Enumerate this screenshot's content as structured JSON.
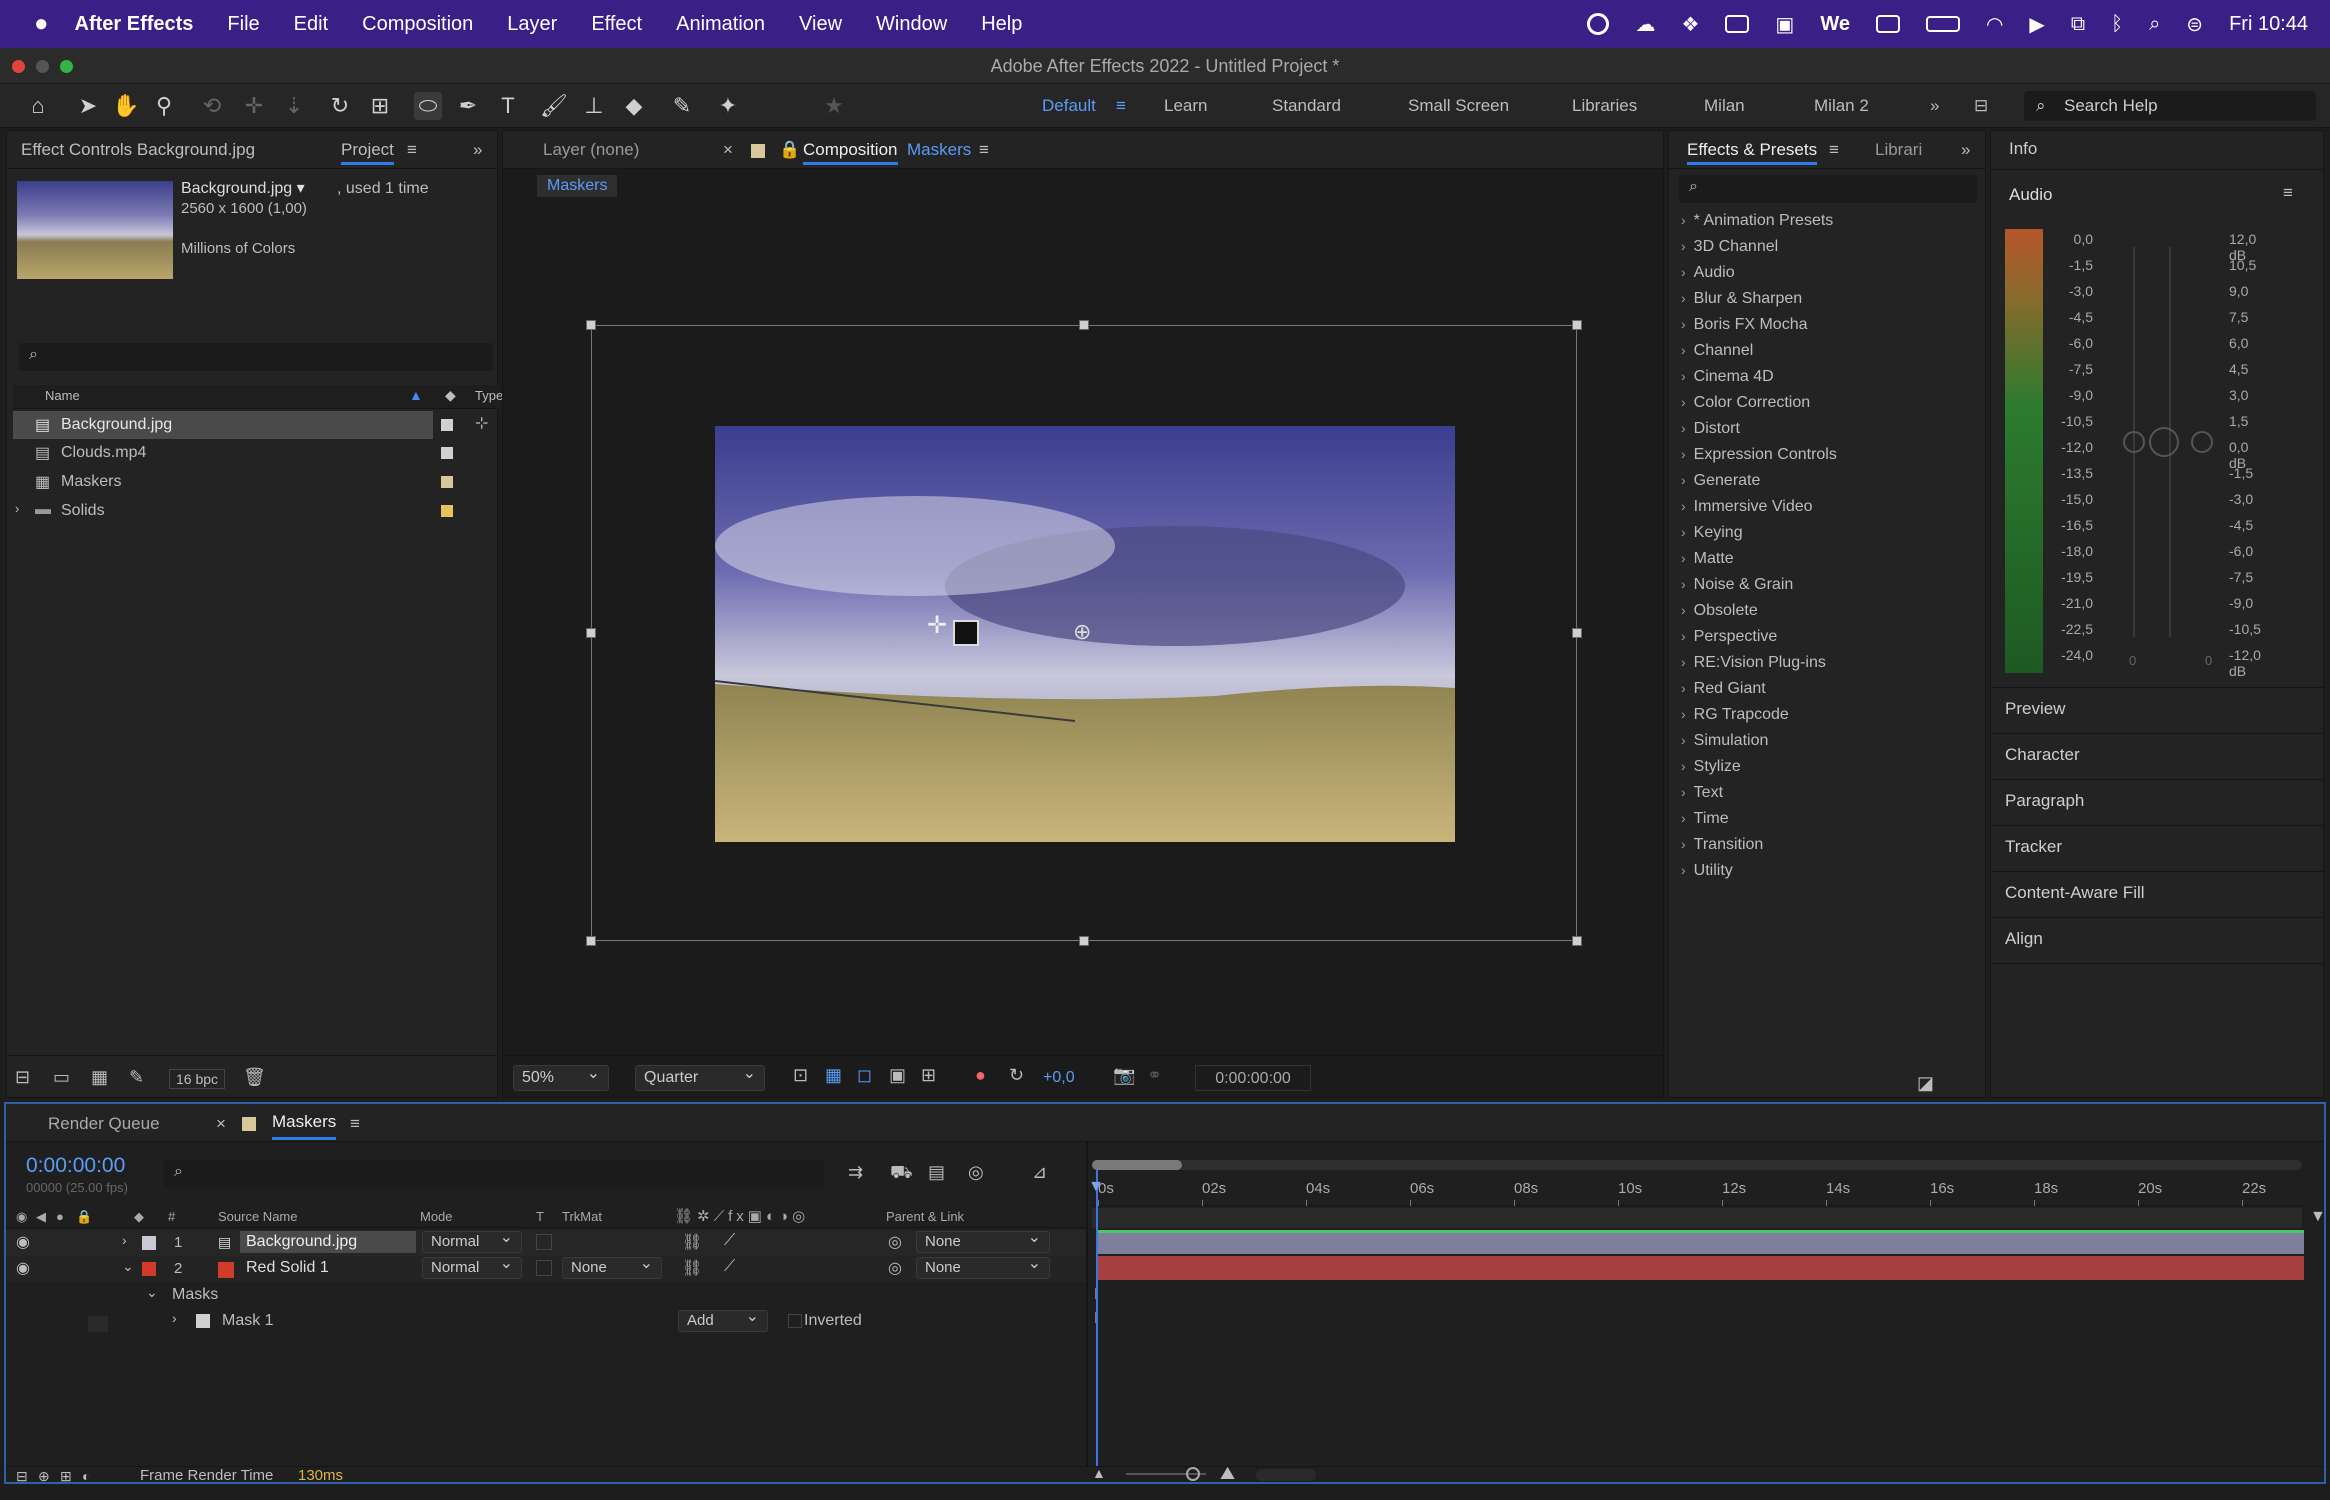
{
  "menubar": {
    "app": "After Effects",
    "items": [
      "File",
      "Edit",
      "Composition",
      "Layer",
      "Effect",
      "Animation",
      "View",
      "Window",
      "Help"
    ],
    "clock": "Fri 10:44"
  },
  "window_title": "Adobe After Effects 2022 - Untitled Project *",
  "workspaces": {
    "default": "Default",
    "items": [
      "Learn",
      "Standard",
      "Small Screen",
      "Libraries",
      "Milan",
      "Milan 2"
    ]
  },
  "search_help": "Search Help",
  "project_panel": {
    "tab_effect_controls": "Effect Controls Background.jpg",
    "tab_project": "Project",
    "preview_name": "Background.jpg ▾",
    "preview_used": ", used 1 time",
    "preview_dims": "2560 x 1600 (1,00)",
    "preview_colors": "Millions of Colors",
    "col_name": "Name",
    "col_type": "Type",
    "items": [
      {
        "name": "Background.jpg",
        "color": "#d0d0d0"
      },
      {
        "name": "Clouds.mp4",
        "color": "#d0d0d0"
      },
      {
        "name": "Maskers",
        "color": "#d8c79b"
      },
      {
        "name": "Solids",
        "color": "#e6c25a"
      }
    ],
    "bpc": "16 bpc"
  },
  "viewer": {
    "tab_layer": "Layer (none)",
    "tab_comp_prefix": "Composition",
    "tab_comp_name": "Maskers",
    "breadcrumb": "Maskers",
    "zoom": "50%",
    "resolution": "Quarter",
    "exposure": "+0,0",
    "timecode": "0:00:00:00"
  },
  "effects_panel": {
    "tab": "Effects & Presets",
    "tab2": "Librari",
    "items": [
      "* Animation Presets",
      "3D Channel",
      "Audio",
      "Blur & Sharpen",
      "Boris FX Mocha",
      "Channel",
      "Cinema 4D",
      "Color Correction",
      "Distort",
      "Expression Controls",
      "Generate",
      "Immersive Video",
      "Keying",
      "Matte",
      "Noise & Grain",
      "Obsolete",
      "Perspective",
      "RE:Vision Plug-ins",
      "Red Giant",
      "RG Trapcode",
      "Simulation",
      "Stylize",
      "Text",
      "Time",
      "Transition",
      "Utility"
    ]
  },
  "right_panel": {
    "info": "Info",
    "audio": "Audio",
    "left_scale": [
      "0,0",
      "-1,5",
      "-3,0",
      "-4,5",
      "-6,0",
      "-7,5",
      "-9,0",
      "-10,5",
      "-12,0",
      "-13,5",
      "-15,0",
      "-16,5",
      "-18,0",
      "-19,5",
      "-21,0",
      "-22,5",
      "-24,0"
    ],
    "right_scale": [
      "12,0 dB",
      "10,5",
      "9,0",
      "7,5",
      "6,0",
      "4,5",
      "3,0",
      "1,5",
      "0,0 dB",
      "-1,5",
      "-3,0",
      "-4,5",
      "-6,0",
      "-7,5",
      "-9,0",
      "-10,5",
      "-12,0 dB"
    ],
    "slider_min_l": "0",
    "slider_min_r": "0",
    "panels": [
      "Preview",
      "Character",
      "Paragraph",
      "Tracker",
      "Content-Aware Fill",
      "Align"
    ]
  },
  "timeline": {
    "tab_render": "Render Queue",
    "tab_comp": "Maskers",
    "timecode": "0:00:00:00",
    "frame_info": "00000 (25.00 fps)",
    "cols": {
      "hash": "#",
      "source": "Source Name",
      "mode": "Mode",
      "t": "T",
      "trkmat": "TrkMat",
      "parent": "Parent & Link"
    },
    "layers": [
      {
        "num": "1",
        "name": "Background.jpg",
        "mode": "Normal",
        "trkmat": "",
        "parent": "None",
        "color": "#c9c9d6"
      },
      {
        "num": "2",
        "name": "Red Solid 1",
        "mode": "Normal",
        "trkmat": "None",
        "parent": "None",
        "color": "#d23a2a"
      }
    ],
    "masks_label": "Masks",
    "mask_name": "Mask 1",
    "mask_mode": "Add",
    "mask_inverted": "Inverted",
    "ruler": [
      "0s",
      "02s",
      "04s",
      "06s",
      "08s",
      "10s",
      "12s",
      "14s",
      "16s",
      "18s",
      "20s",
      "22s"
    ],
    "status_label": "Frame Render Time",
    "status_value": "130ms"
  }
}
